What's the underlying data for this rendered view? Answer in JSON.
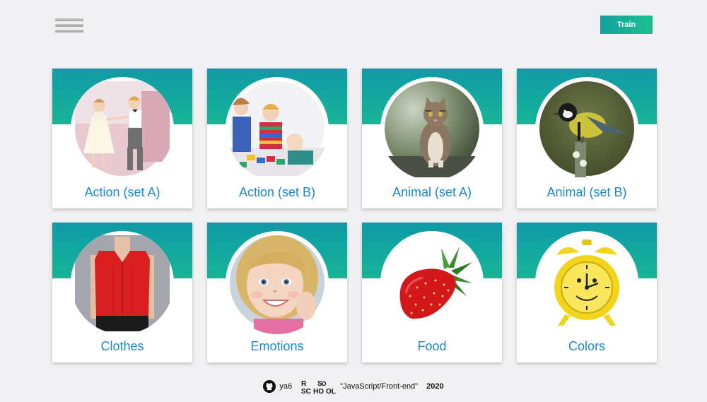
{
  "header": {
    "menu_icon": "hamburger-menu-icon",
    "train_label": "Train"
  },
  "colors": {
    "card_gradient_top": "#0f9aa6",
    "card_gradient_bottom": "#17b596",
    "title_text": "#1d88c9",
    "train_gradient": [
      "#12a1a0",
      "#1ebf8f"
    ],
    "background": "#f1f1f3"
  },
  "cards": [
    {
      "title": "Action (set A)",
      "image": "children-dancing-image"
    },
    {
      "title": "Action (set B)",
      "image": "children-playing-toys-image"
    },
    {
      "title": "Animal (set A)",
      "image": "cat-image"
    },
    {
      "title": "Animal (set B)",
      "image": "bird-tit-image"
    },
    {
      "title": "Clothes",
      "image": "red-blouse-image"
    },
    {
      "title": "Emotions",
      "image": "smiling-girl-image"
    },
    {
      "title": "Food",
      "image": "strawberry-image"
    },
    {
      "title": "Colors",
      "image": "yellow-alarm-clock-image"
    }
  ],
  "footer": {
    "github_icon": "github-icon",
    "github_user": "ya6",
    "school_logo": "rs-school-logo",
    "school_logo_text": "RS SCHOOL",
    "course": "\"JavaScript/Front-end\"",
    "year": "2020"
  }
}
